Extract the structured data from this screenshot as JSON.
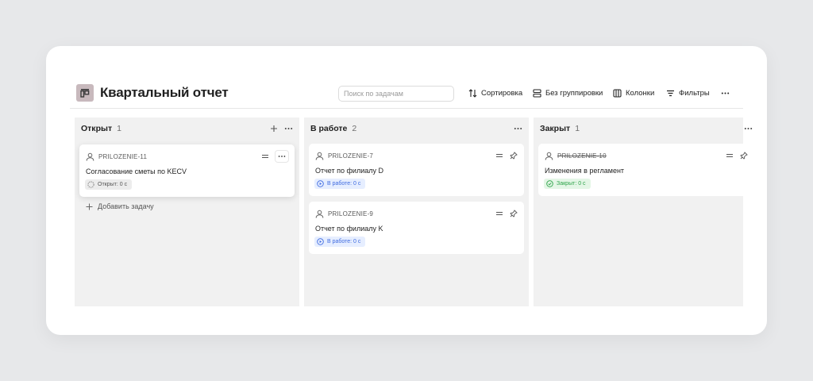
{
  "header": {
    "title": "Квартальный отчет",
    "search_placeholder": "Поиск по задачам",
    "tools": {
      "sort": "Сортировка",
      "group": "Без группировки",
      "columns": "Колонки",
      "filters": "Фильтры"
    }
  },
  "columns": [
    {
      "title": "Открыт",
      "count": "1",
      "cards": [
        {
          "id": "PRILOZENIE-11",
          "name": "Согласование сметы по KECV",
          "status": "Открыт: 0 с"
        }
      ],
      "add_task": "Добавить задачу"
    },
    {
      "title": "В работе",
      "count": "2",
      "cards": [
        {
          "id": "PRILOZENIE-7",
          "name": "Отчет по филиалу D",
          "status": "В работе: 0 с"
        },
        {
          "id": "PRILOZENIE-9",
          "name": "Отчет по филиалу K",
          "status": "В работе: 0 с"
        }
      ]
    },
    {
      "title": "Закрыт",
      "count": "1",
      "cards": [
        {
          "id": "PRILOZENIE-10",
          "name": "Изменения в регламент",
          "status": "Закрыт: 0 с"
        }
      ]
    }
  ],
  "colors": {
    "open_badge": "#ececec",
    "work_badge": "#e6eeff",
    "work_text": "#3f6be0",
    "closed_badge": "#e4f6e6",
    "closed_text": "#2ea44a",
    "logo": "#c8b9bd"
  },
  "icons": [
    "board-icon",
    "sort-icon",
    "group-icon",
    "columns-icon",
    "filter-icon",
    "more-icon",
    "plus-icon",
    "user-icon",
    "drag-handle-icon",
    "pin-icon",
    "status-open-icon",
    "status-play-icon",
    "status-check-icon"
  ]
}
